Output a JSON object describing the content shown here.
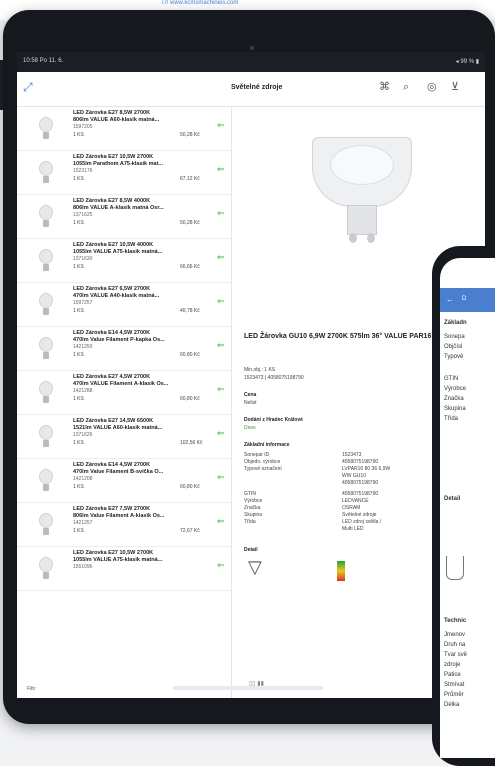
{
  "app": {
    "status_time": "10:58 Po 11. 6.",
    "status_right": "◂ 99 % ▮",
    "title": "Světelné zdroje",
    "pager": "▯▯ ▮▮"
  },
  "top_caption": "i:// www.kcmsmachineis.com",
  "products": [
    {
      "line1": "LED Žárovka E27 8,5W 2700K",
      "line2": "806lm VALUE A60-klasik matná...",
      "code": "1597205",
      "stock": "1 KS",
      "price": "50,28 Kč"
    },
    {
      "line1": "LED Žárovka E27 10,5W 2700K",
      "line2": "1055lm Parathom A75-klasik mat...",
      "code": "1523176",
      "stock": "1 KS",
      "price": "67,12 Kč"
    },
    {
      "line1": "LED Žárovka E27 8,5W 4000K",
      "line2": "806lm VALUE A-klasik matná Osr...",
      "code": "1371625",
      "stock": "1 KS",
      "price": "50,28 Kč"
    },
    {
      "line1": "LED Žárovka E27 10,5W 4000K",
      "line2": "1055lm VALUE A75-klasik matná...",
      "code": "1371630",
      "stock": "1 KS",
      "price": "66,66 Kč"
    },
    {
      "line1": "LED Žárovka E27 6,5W 2700K",
      "line2": "470lm VALUE A40-klasik matná...",
      "code": "1597257",
      "stock": "1 KS",
      "price": "40,78 Kč"
    },
    {
      "line1": "LED Žárovka E14 4,5W 2700K",
      "line2": "470lm Value Filament P-kapka Os...",
      "code": "1421250",
      "stock": "1 KS",
      "price": "60,80 Kč"
    },
    {
      "line1": "LED Žárovka E27 4,5W 2700K",
      "line2": "470lm VALUE Filament A-klasik Os...",
      "code": "1421288",
      "stock": "1 KS",
      "price": "60,80 Kč"
    },
    {
      "line1": "LED Žárovka E27 14,5W 6500K",
      "line2": "1521lm VALUE A60-klasik matná...",
      "code": "1371626",
      "stock": "1 KS",
      "price": "102,56 Kč"
    },
    {
      "line1": "LED Žárovka E14 4,5W 2700K",
      "line2": "470lm Value Filament B-svíčka O...",
      "code": "1421208",
      "stock": "1 KS",
      "price": "60,80 Kč"
    },
    {
      "line1": "LED Žárovka E27 7,5W 2700K",
      "line2": "806lm Value Filament A-klasik Os...",
      "code": "1421257",
      "stock": "1 KS",
      "price": "72,67 Kč"
    },
    {
      "line1": "LED Žárovka E27 10,5W 2700K",
      "line2": "1055lm VALUE A75-klasik matná...",
      "code": "1551096",
      "stock": "",
      "price": ""
    }
  ],
  "detail": {
    "title": "LED Žárovka GU10 6,9W 2700K 575lm 36° VALUE PAR16 80 Osram",
    "min_label": "Min.obj.: 1 KS",
    "codes": "1523473 | 4058075198790",
    "price_label": "Cena",
    "price_value": "Nelist",
    "delivery_label": "Dodání z Hradec Králové",
    "delivery_value": "Dnes",
    "basic_info": "Základní informace",
    "detail_label": "Detail",
    "specs": [
      {
        "k": "Sonepar ID",
        "v": "1523473"
      },
      {
        "k": "Objedn. výrobce",
        "v": "4058075198790 "
      },
      {
        "k": "Typové označení",
        "v": "LVPAR16 80 36 6,9W"
      },
      {
        "k": "",
        "v": "WW GU10"
      },
      {
        "k": "",
        "v": "4058075198790"
      },
      {
        "k": "GTIN",
        "v": "4058075198790"
      },
      {
        "k": "Výrobce",
        "v": "LEDVANCE"
      },
      {
        "k": "Značka",
        "v": "OSRAM"
      },
      {
        "k": "Skupina",
        "v": "Světelné zdroje"
      },
      {
        "k": "Třída",
        "v": "LED zdroj světla /"
      },
      {
        "k": "",
        "v": "Multi LED"
      }
    ]
  },
  "bottom": {
    "filter": "Filtr"
  },
  "phone": {
    "header": "D",
    "lines": [
      "Základn",
      "Sonepa",
      "Objčísl",
      "Typové",
      "",
      "GTIN",
      "Výrobce",
      "Značka",
      "Skupina",
      "Třída",
      "",
      "",
      "Detail"
    ],
    "tech_lines": [
      "Technic",
      "Jmenov",
      "Druh na",
      "Tvar svě",
      "zdroje",
      "Patice",
      "Stmívat",
      "Průměr",
      "Délka"
    ]
  }
}
